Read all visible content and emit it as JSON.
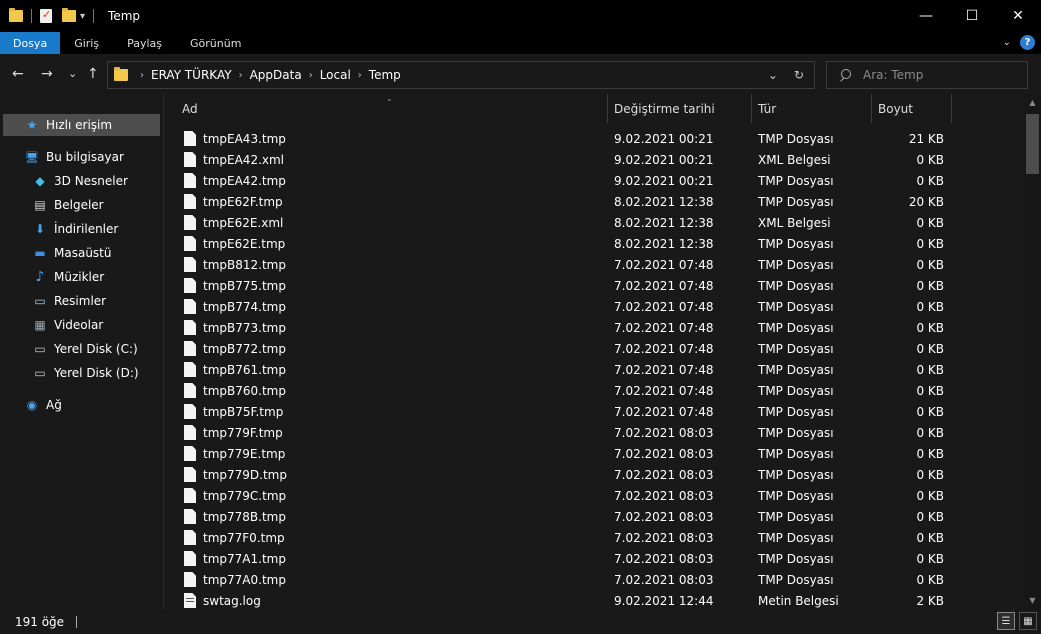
{
  "window": {
    "title": "Temp",
    "min_glyph": "—",
    "max_glyph": "☐",
    "close_glyph": "✕"
  },
  "ribbon": {
    "tabs": [
      "Dosya",
      "Giriş",
      "Paylaş",
      "Görünüm"
    ],
    "active": "Dosya",
    "help_glyph": "?",
    "expand_glyph": "⌄"
  },
  "nav": {
    "back_glyph": "←",
    "forward_glyph": "→",
    "recent_glyph": "⌄",
    "up_glyph": "↑"
  },
  "address": {
    "crumbs": [
      "ERAY TÜRKAY",
      "AppData",
      "Local",
      "Temp"
    ],
    "chevron": "›",
    "dropdown_glyph": "⌄",
    "refresh_glyph": "↻"
  },
  "search": {
    "placeholder": "Ara: Temp"
  },
  "sidebar": {
    "items": [
      {
        "label": "Hızlı erişim",
        "icon": "star-icon",
        "glyph": "★",
        "color": "#4aa3f0"
      },
      {
        "label": "Bu bilgisayar",
        "icon": "computer-icon",
        "glyph": "🖥",
        "color": "#4aa3f0"
      },
      {
        "label": "3D Nesneler",
        "icon": "cube-icon",
        "glyph": "◆",
        "color": "#3fc1e8"
      },
      {
        "label": "Belgeler",
        "icon": "document-icon",
        "glyph": "▤",
        "color": "#d8d8d8"
      },
      {
        "label": "İndirilenler",
        "icon": "download-icon",
        "glyph": "⬇",
        "color": "#4aa3f0"
      },
      {
        "label": "Masaüstü",
        "icon": "desktop-icon",
        "glyph": "▬",
        "color": "#3a8fe0"
      },
      {
        "label": "Müzikler",
        "icon": "music-icon",
        "glyph": "♪",
        "color": "#4aa3f0"
      },
      {
        "label": "Resimler",
        "icon": "picture-icon",
        "glyph": "▭",
        "color": "#9fc7e8"
      },
      {
        "label": "Videolar",
        "icon": "video-icon",
        "glyph": "▦",
        "color": "#9aa6b2"
      },
      {
        "label": "Yerel Disk (C:)",
        "icon": "drive-c-icon",
        "glyph": "▭",
        "color": "#bfc6cc"
      },
      {
        "label": "Yerel Disk (D:)",
        "icon": "drive-d-icon",
        "glyph": "▭",
        "color": "#bfc6cc"
      },
      {
        "label": "Ağ",
        "icon": "network-icon",
        "glyph": "◉",
        "color": "#4aa3f0"
      }
    ]
  },
  "columns": {
    "name": "Ad",
    "date": "Değiştirme tarihi",
    "type": "Tür",
    "size": "Boyut",
    "sort_glyph": "⌄"
  },
  "files": [
    {
      "name": "tmpEA43.tmp",
      "date": "9.02.2021 00:21",
      "type": "TMP Dosyası",
      "size": "21 KB"
    },
    {
      "name": "tmpEA42.xml",
      "date": "9.02.2021 00:21",
      "type": "XML Belgesi",
      "size": "0 KB"
    },
    {
      "name": "tmpEA42.tmp",
      "date": "9.02.2021 00:21",
      "type": "TMP Dosyası",
      "size": "0 KB"
    },
    {
      "name": "tmpE62F.tmp",
      "date": "8.02.2021 12:38",
      "type": "TMP Dosyası",
      "size": "20 KB"
    },
    {
      "name": "tmpE62E.xml",
      "date": "8.02.2021 12:38",
      "type": "XML Belgesi",
      "size": "0 KB"
    },
    {
      "name": "tmpE62E.tmp",
      "date": "8.02.2021 12:38",
      "type": "TMP Dosyası",
      "size": "0 KB"
    },
    {
      "name": "tmpB812.tmp",
      "date": "7.02.2021 07:48",
      "type": "TMP Dosyası",
      "size": "0 KB"
    },
    {
      "name": "tmpB775.tmp",
      "date": "7.02.2021 07:48",
      "type": "TMP Dosyası",
      "size": "0 KB"
    },
    {
      "name": "tmpB774.tmp",
      "date": "7.02.2021 07:48",
      "type": "TMP Dosyası",
      "size": "0 KB"
    },
    {
      "name": "tmpB773.tmp",
      "date": "7.02.2021 07:48",
      "type": "TMP Dosyası",
      "size": "0 KB"
    },
    {
      "name": "tmpB772.tmp",
      "date": "7.02.2021 07:48",
      "type": "TMP Dosyası",
      "size": "0 KB"
    },
    {
      "name": "tmpB761.tmp",
      "date": "7.02.2021 07:48",
      "type": "TMP Dosyası",
      "size": "0 KB"
    },
    {
      "name": "tmpB760.tmp",
      "date": "7.02.2021 07:48",
      "type": "TMP Dosyası",
      "size": "0 KB"
    },
    {
      "name": "tmpB75F.tmp",
      "date": "7.02.2021 07:48",
      "type": "TMP Dosyası",
      "size": "0 KB"
    },
    {
      "name": "tmp779F.tmp",
      "date": "7.02.2021 08:03",
      "type": "TMP Dosyası",
      "size": "0 KB"
    },
    {
      "name": "tmp779E.tmp",
      "date": "7.02.2021 08:03",
      "type": "TMP Dosyası",
      "size": "0 KB"
    },
    {
      "name": "tmp779D.tmp",
      "date": "7.02.2021 08:03",
      "type": "TMP Dosyası",
      "size": "0 KB"
    },
    {
      "name": "tmp779C.tmp",
      "date": "7.02.2021 08:03",
      "type": "TMP Dosyası",
      "size": "0 KB"
    },
    {
      "name": "tmp778B.tmp",
      "date": "7.02.2021 08:03",
      "type": "TMP Dosyası",
      "size": "0 KB"
    },
    {
      "name": "tmp77F0.tmp",
      "date": "7.02.2021 08:03",
      "type": "TMP Dosyası",
      "size": "0 KB"
    },
    {
      "name": "tmp77A1.tmp",
      "date": "7.02.2021 08:03",
      "type": "TMP Dosyası",
      "size": "0 KB"
    },
    {
      "name": "tmp77A0.tmp",
      "date": "7.02.2021 08:03",
      "type": "TMP Dosyası",
      "size": "0 KB"
    },
    {
      "name": "swtag.log",
      "date": "9.02.2021 12:44",
      "type": "Metin Belgesi",
      "size": "2 KB",
      "icon": "log"
    }
  ],
  "status": {
    "count": "191 öğe"
  },
  "colors": {
    "accent": "#1979ca",
    "background": "#191919",
    "selection": "#4d4d4d"
  }
}
